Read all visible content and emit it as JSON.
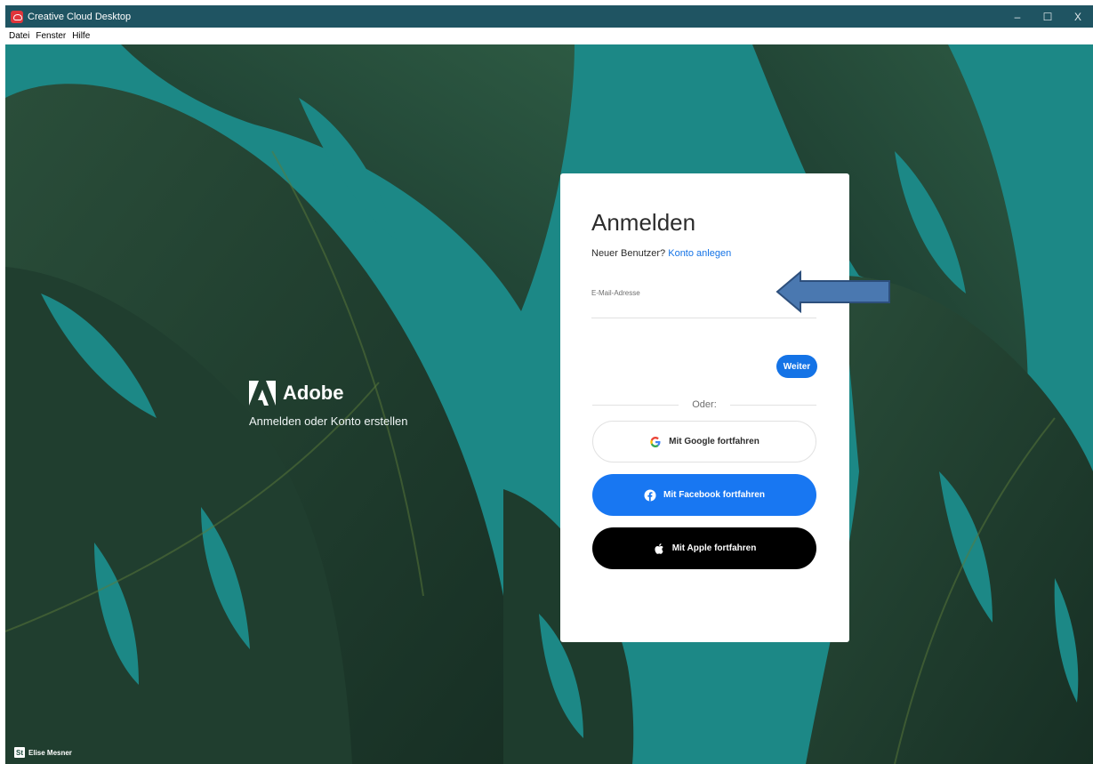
{
  "window": {
    "title": "Creative Cloud Desktop",
    "controls": {
      "minimize": "–",
      "maximize": "☐",
      "close": "X"
    }
  },
  "menubar": {
    "items": [
      {
        "label": "Datei"
      },
      {
        "label": "Fenster"
      },
      {
        "label": "Hilfe"
      }
    ]
  },
  "brand": {
    "name": "Adobe",
    "tagline": "Anmelden oder Konto erstellen"
  },
  "login": {
    "title": "Anmelden",
    "new_user_text": "Neuer Benutzer?",
    "create_account_link": "Konto anlegen",
    "email_label": "E-Mail-Adresse",
    "email_value": "",
    "next_button": "Weiter",
    "or_text": "Oder:",
    "google_button": "Mit Google fortfahren",
    "facebook_button": "Mit Facebook fortfahren",
    "apple_button": "Mit Apple fortfahren"
  },
  "user": {
    "badge": "St",
    "name": "Elise Mesner"
  },
  "colors": {
    "titlebar": "#1f5462",
    "background": "#1c8886",
    "leaf": "#1f3f30",
    "accent_blue": "#1473e6",
    "facebook_blue": "#1877f2",
    "apple_black": "#000000",
    "annotation_arrow": "#4a78b0"
  },
  "icons": {
    "app": "creative-cloud-icon",
    "adobe": "adobe-logo-icon",
    "google": "google-icon",
    "facebook": "facebook-icon",
    "apple": "apple-icon",
    "annotation": "left-arrow-annotation-icon"
  }
}
